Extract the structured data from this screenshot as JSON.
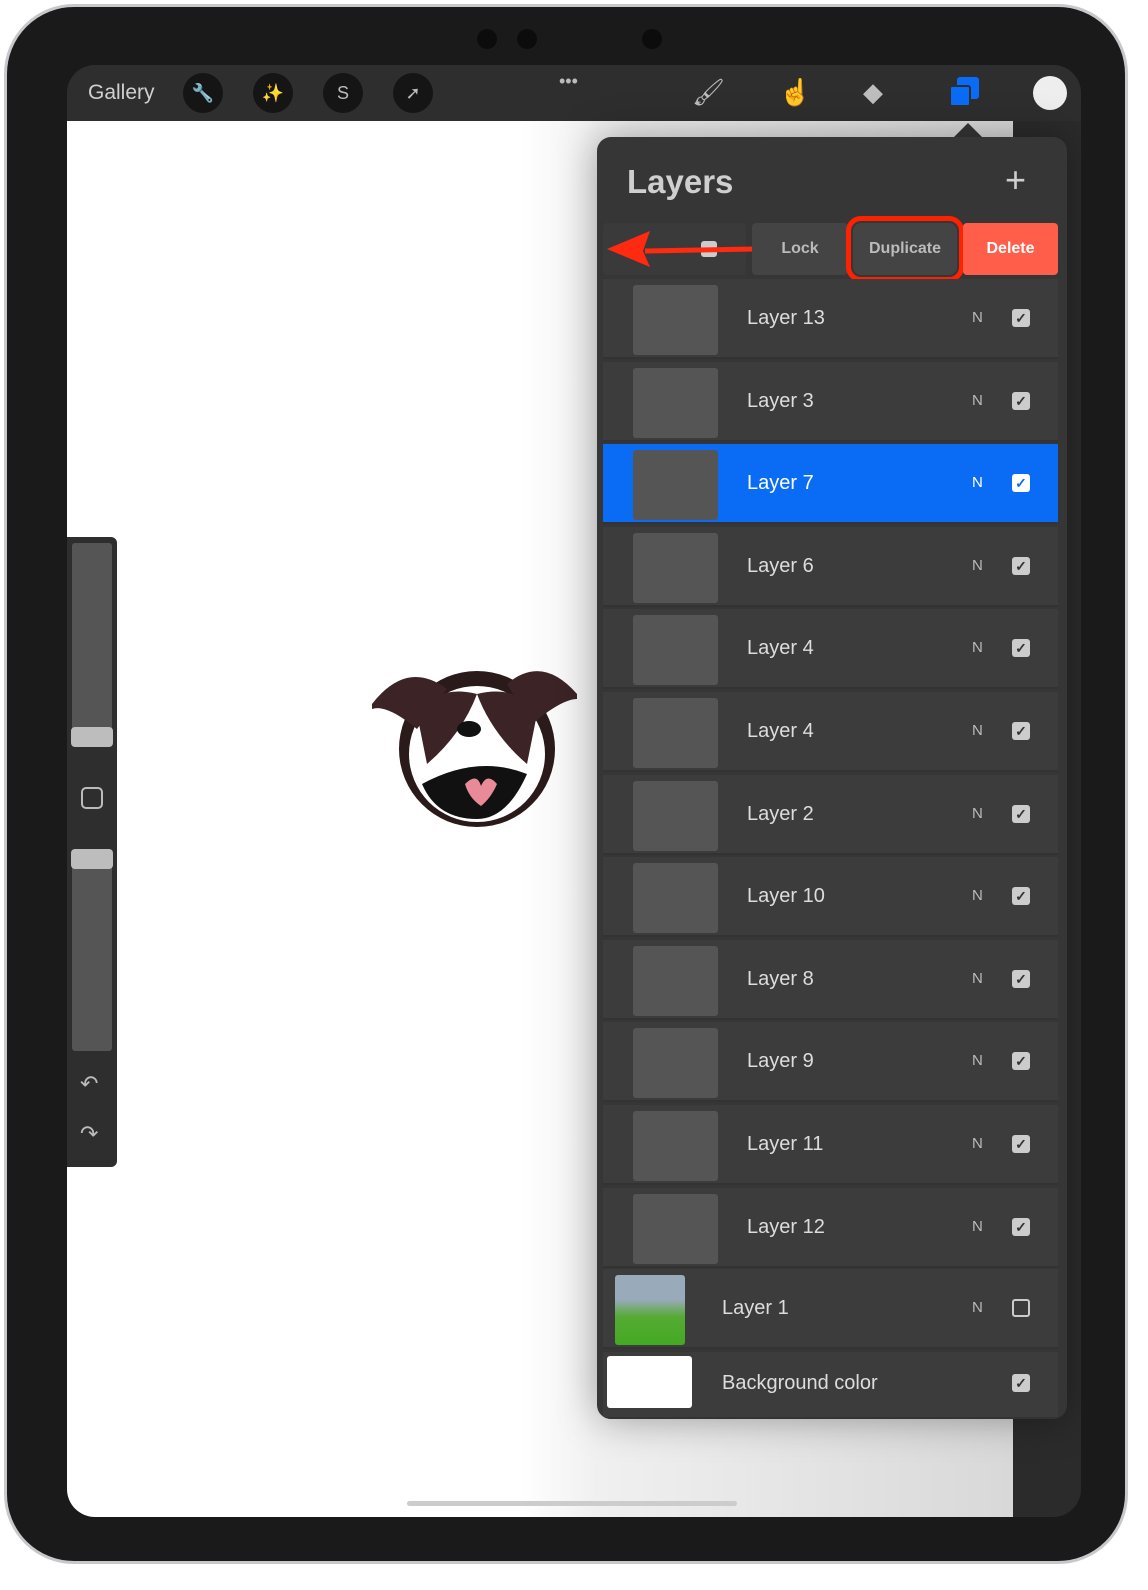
{
  "topbar": {
    "gallery": "Gallery",
    "icons": [
      "wrench-icon",
      "magic-wand-icon",
      "selection-s-icon",
      "arrow-transform-icon"
    ],
    "more": "•••",
    "tools": [
      "brush-icon",
      "smudge-icon",
      "eraser-icon",
      "layers-icon",
      "color-icon"
    ],
    "accent": "#0a6cf5"
  },
  "layers": {
    "title": "Layers",
    "add": "+",
    "swipe": {
      "lock": "Lock",
      "duplicate": "Duplicate",
      "delete": "Delete",
      "delete_color": "#ff5e4a",
      "highlight_color": "#ff2200"
    },
    "items": [
      {
        "name": "Layer 13",
        "mode": "N",
        "visible": true
      },
      {
        "name": "Layer 3",
        "mode": "N",
        "visible": true
      },
      {
        "name": "Layer 7",
        "mode": "N",
        "visible": true,
        "selected": true
      },
      {
        "name": "Layer 6",
        "mode": "N",
        "visible": true
      },
      {
        "name": "Layer 4",
        "mode": "N",
        "visible": true
      },
      {
        "name": "Layer 4",
        "mode": "N",
        "visible": true
      },
      {
        "name": "Layer 2",
        "mode": "N",
        "visible": true
      },
      {
        "name": "Layer 10",
        "mode": "N",
        "visible": true
      },
      {
        "name": "Layer 8",
        "mode": "N",
        "visible": true
      },
      {
        "name": "Layer 9",
        "mode": "N",
        "visible": true
      },
      {
        "name": "Layer 11",
        "mode": "N",
        "visible": true
      },
      {
        "name": "Layer 12",
        "mode": "N",
        "visible": true
      },
      {
        "name": "Layer 1",
        "mode": "N",
        "visible": false
      }
    ],
    "background": {
      "name": "Background color",
      "visible": true
    }
  }
}
